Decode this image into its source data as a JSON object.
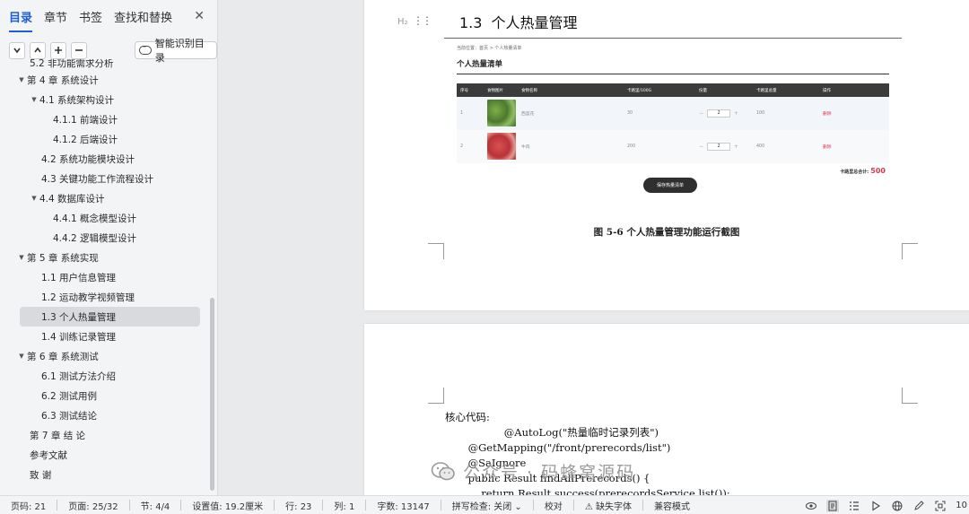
{
  "nav": {
    "tabs": [
      "目录",
      "章节",
      "书签",
      "查找和替换"
    ],
    "active_tab": 0,
    "close_glyph": "✕",
    "smart_toc_label": "智能识别目录",
    "toc": [
      {
        "text": "5.2  非功能需求分析",
        "level": "l1n",
        "caret": "",
        "partial": true
      },
      {
        "text": "第 4 章  系统设计",
        "level": "l1",
        "caret": "▼"
      },
      {
        "text": "4.1  系统架构设计",
        "level": "l2",
        "caret": "▼"
      },
      {
        "text": "4.1.1  前端设计",
        "level": "l3",
        "caret": ""
      },
      {
        "text": "4.1.2  后端设计",
        "level": "l3",
        "caret": ""
      },
      {
        "text": "4.2  系统功能模块设计",
        "level": "l2n",
        "caret": ""
      },
      {
        "text": "4.3  关键功能工作流程设计",
        "level": "l2n",
        "caret": ""
      },
      {
        "text": "4.4  数据库设计",
        "level": "l2",
        "caret": "▼"
      },
      {
        "text": "4.4.1  概念模型设计",
        "level": "l3",
        "caret": ""
      },
      {
        "text": "4.4.2  逻辑模型设计",
        "level": "l3",
        "caret": ""
      },
      {
        "text": "第 5 章  系统实现",
        "level": "l1",
        "caret": "▼"
      },
      {
        "text": "1.1  用户信息管理",
        "level": "l2n",
        "caret": ""
      },
      {
        "text": "1.2  运动教学视频管理",
        "level": "l2n",
        "caret": ""
      },
      {
        "text": "1.3  个人热量管理",
        "level": "l2n",
        "caret": "",
        "selected": true
      },
      {
        "text": "1.4  训练记录管理",
        "level": "l2n",
        "caret": ""
      },
      {
        "text": "第 6 章  系统测试",
        "level": "l1",
        "caret": "▼"
      },
      {
        "text": "6.1  测试方法介绍",
        "level": "l2n",
        "caret": ""
      },
      {
        "text": "6.2  测试用例",
        "level": "l2n",
        "caret": ""
      },
      {
        "text": "6.3  测试结论",
        "level": "l2n",
        "caret": ""
      },
      {
        "text": "第 7 章    结    论",
        "level": "l1n",
        "caret": ""
      },
      {
        "text": "参考文献",
        "level": "l1n",
        "caret": ""
      },
      {
        "text": "致    谢",
        "level": "l1n",
        "caret": ""
      }
    ]
  },
  "doc": {
    "h_tool_label": "H₂",
    "heading_num": "1.3",
    "heading_text": "个人热量管理",
    "shot": {
      "crumb": "当前位置：首页 > 个人热量清单",
      "title": "个人热量清单",
      "headers": [
        "序号",
        "食物图片",
        "食物名称",
        "卡路里/100G",
        "份量",
        "卡路里总量",
        "操作"
      ],
      "rows": [
        {
          "no": "1",
          "img": "broc",
          "name": "西蓝花",
          "kcal": "30",
          "qty": "2",
          "total": "100",
          "op": "删除"
        },
        {
          "no": "2",
          "img": "beef",
          "name": "牛肉",
          "kcal": "200",
          "qty": "2",
          "total": "400",
          "op": "删除"
        }
      ],
      "total_label": "卡路里总合计:",
      "total_value": "500",
      "save_label": "保存热量清单"
    },
    "caption": "图 5-6  个人热量管理功能运行截图",
    "code_lines": [
      "核心代码:",
      "                  @AutoLog(\"热量临时记录列表\")",
      "       @GetMapping(\"/front/prerecords/list\")",
      "       @SaIgnore",
      "       public Result findAllPrerecords() {",
      "           return Result.success(prerecordsService.list());"
    ]
  },
  "watermark": "公众号 · 码蜂窝源码",
  "status": {
    "items": [
      "页码: 21",
      "页面: 25/32",
      "节: 4/4",
      "设置值: 19.2厘米",
      "行: 23",
      "列: 1",
      "字数: 13147",
      "拼写检查: 关闭 ⌄",
      "校对",
      "⚠ 缺失字体",
      "兼容模式"
    ],
    "zoom": "10"
  }
}
